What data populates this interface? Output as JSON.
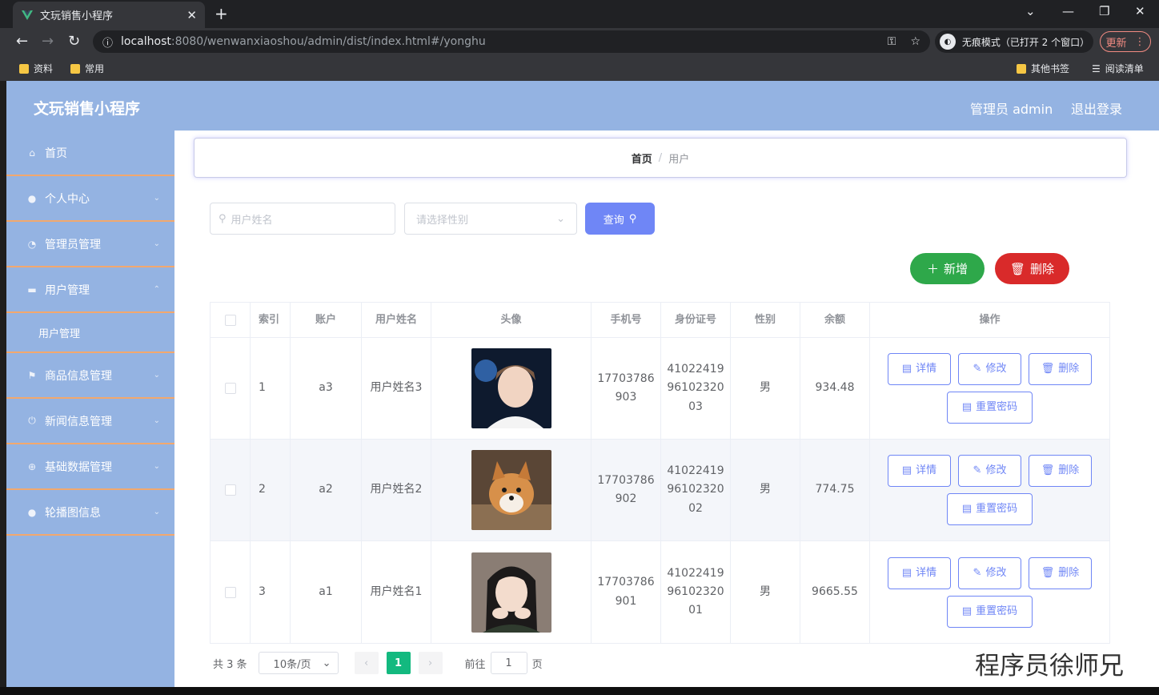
{
  "browser": {
    "tab_title": "文玩销售小程序",
    "url_host": "localhost",
    "url_rest": ":8080/wenwanxiaoshou/admin/dist/index.html#/yonghu",
    "incognito_label": "无痕模式（已打开 2 个窗口）",
    "update_label": "更新",
    "bookmarks": [
      "资料",
      "常用"
    ],
    "other_bookmarks": "其他书签",
    "reading_list": "阅读清单"
  },
  "app": {
    "title": "文玩销售小程序",
    "user_label": "管理员 admin",
    "logout_label": "退出登录"
  },
  "sidebar": {
    "items": [
      {
        "label": "首页",
        "icon": "home-icon"
      },
      {
        "label": "个人中心",
        "icon": "user-icon"
      },
      {
        "label": "管理员管理",
        "icon": "gauge-icon"
      },
      {
        "label": "用户管理",
        "icon": "chat-icon"
      },
      {
        "label": "用户管理"
      },
      {
        "label": "商品信息管理",
        "icon": "flag-icon"
      },
      {
        "label": "新闻信息管理",
        "icon": "power-icon"
      },
      {
        "label": "基础数据管理",
        "icon": "crosshair-icon"
      },
      {
        "label": "轮播图信息",
        "icon": "bulb-icon"
      }
    ]
  },
  "breadcrumb": {
    "home": "首页",
    "separator": "/",
    "current": "用户"
  },
  "search": {
    "name_placeholder": "用户姓名",
    "gender_placeholder": "请选择性别",
    "query_label": "查询"
  },
  "actions": {
    "add_label": "新增",
    "delete_label": "删除"
  },
  "table": {
    "headers": [
      "索引",
      "账户",
      "用户姓名",
      "头像",
      "手机号",
      "身份证号",
      "性别",
      "余额",
      "操作"
    ],
    "rows": [
      {
        "index": "1",
        "account": "a3",
        "name": "用户姓名3",
        "phone1": "17703786",
        "phone2": "903",
        "id1": "41022419",
        "id2": "96102320",
        "id3": "03",
        "gender": "男",
        "balance": "934.48"
      },
      {
        "index": "2",
        "account": "a2",
        "name": "用户姓名2",
        "phone1": "17703786",
        "phone2": "902",
        "id1": "41022419",
        "id2": "96102320",
        "id3": "02",
        "gender": "男",
        "balance": "774.75"
      },
      {
        "index": "3",
        "account": "a1",
        "name": "用户姓名1",
        "phone1": "17703786",
        "phone2": "901",
        "id1": "41022419",
        "id2": "96102320",
        "id3": "01",
        "gender": "男",
        "balance": "9665.55"
      }
    ],
    "ops": {
      "detail": "详情",
      "edit": "修改",
      "delete": "删除",
      "reset": "重置密码"
    }
  },
  "pager": {
    "total": "共 3 条",
    "page_size": "10条/页",
    "current": "1",
    "goto": "前往",
    "goto_value": "1",
    "page_unit": "页"
  },
  "watermark": "程序员徐师兄",
  "colors": {
    "header": "#94b3e2",
    "primary": "#6f86f6",
    "success": "#2ea84a",
    "danger": "#d92a2a",
    "pager_active": "#13b97f",
    "menu_divider": "#f2a86e"
  }
}
